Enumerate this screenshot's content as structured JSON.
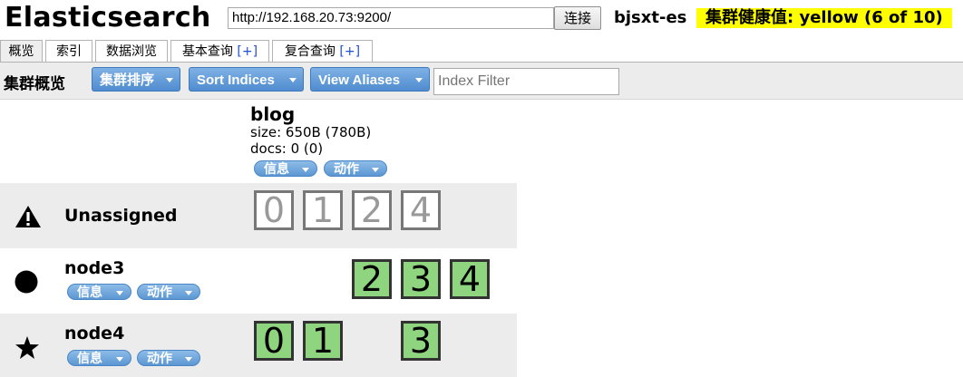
{
  "header": {
    "app_title": "Elasticsearch",
    "url_value": "http://192.168.20.73:9200/",
    "connect_label": "连接",
    "cluster_name": "bjsxt-es",
    "health_label": "集群健康值: yellow (6 of 10)",
    "health_color": "#ffff00"
  },
  "tabs": [
    {
      "label": "概览",
      "plus": ""
    },
    {
      "label": "索引",
      "plus": ""
    },
    {
      "label": "数据浏览",
      "plus": ""
    },
    {
      "label": "基本查询 ",
      "plus": "[+]"
    },
    {
      "label": "复合查询 ",
      "plus": "[+]"
    }
  ],
  "toolbar": {
    "title": "集群概览",
    "sort_cluster_label": "集群排序",
    "sort_indices_label": "Sort Indices",
    "view_aliases_label": "View Aliases",
    "index_filter_placeholder": "Index Filter"
  },
  "index": {
    "name": "blog",
    "size": "size: 650B (780B)",
    "docs": "docs: 0 (0)",
    "info_label": "信息",
    "action_label": "动作"
  },
  "rows": {
    "unassigned": {
      "label": "Unassigned",
      "icon": "warning-icon",
      "shards": [
        "0",
        "1",
        "2",
        "4"
      ]
    },
    "node3": {
      "label": "node3",
      "icon": "circle-icon",
      "info_label": "信息",
      "action_label": "动作",
      "shards": [
        "2",
        "3",
        "4"
      ]
    },
    "node4": {
      "label": "node4",
      "icon": "star-icon",
      "info_label": "信息",
      "action_label": "动作",
      "shards": [
        "0",
        "1",
        "3"
      ]
    }
  },
  "colors": {
    "assigned_shard": "#8fd47e",
    "button_blue": "#5c97d2"
  }
}
